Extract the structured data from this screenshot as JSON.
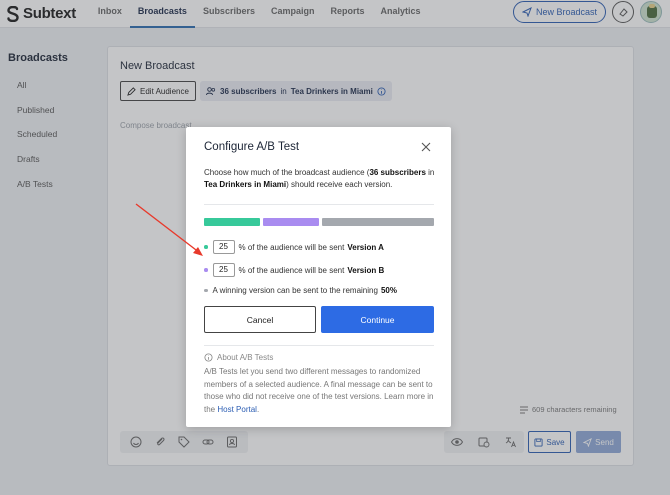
{
  "app": {
    "name": "Subtext"
  },
  "nav": {
    "tabs": [
      {
        "label": "Inbox",
        "active": false
      },
      {
        "label": "Broadcasts",
        "active": true
      },
      {
        "label": "Subscribers",
        "active": false
      },
      {
        "label": "Campaign",
        "active": false
      },
      {
        "label": "Reports",
        "active": false
      },
      {
        "label": "Analytics",
        "active": false
      }
    ],
    "new_broadcast_label": "New Broadcast"
  },
  "sidebar": {
    "title": "Broadcasts",
    "items": [
      "All",
      "Published",
      "Scheduled",
      "Drafts",
      "A/B Tests"
    ]
  },
  "editor": {
    "title": "New Broadcast",
    "edit_audience_label": "Edit Audience",
    "audience_count": "36 subscribers",
    "audience_in": "in",
    "audience_name": "Tea Drinkers in Miami",
    "compose_placeholder": "Compose broadcast",
    "chars_remaining": "609 characters remaining",
    "save_label": "Save",
    "send_label": "Send"
  },
  "modal": {
    "title": "Configure A/B Test",
    "desc_pre": "Choose how much of the broadcast audience (",
    "desc_count": "36 subscribers",
    "desc_in": " in ",
    "desc_audience": "Tea Drinkers in Miami",
    "desc_post": ") should receive each version.",
    "split": {
      "version_a_pct": 25,
      "version_b_pct": 25,
      "remaining_pct": 50
    },
    "version_a_value": "25",
    "version_b_value": "25",
    "row_text": "% of the audience will be sent",
    "version_a_label": "Version A",
    "version_b_label": "Version B",
    "remaining_text": "A winning version can be sent to the remaining",
    "remaining_value": "50%",
    "cancel_label": "Cancel",
    "continue_label": "Continue",
    "about_title": "About A/B Tests",
    "about_body": "A/B Tests let you send two different messages to randomized members of a selected audience. A final message can be sent to those who did not receive one of the test versions. Learn more in the",
    "about_link": "Host Portal",
    "about_end": "."
  },
  "colors": {
    "version_a": "#37c99a",
    "version_b": "#a98cf0",
    "remaining": "#a4a8ae",
    "accent": "#2d6be4",
    "annotation": "#e8392b"
  }
}
